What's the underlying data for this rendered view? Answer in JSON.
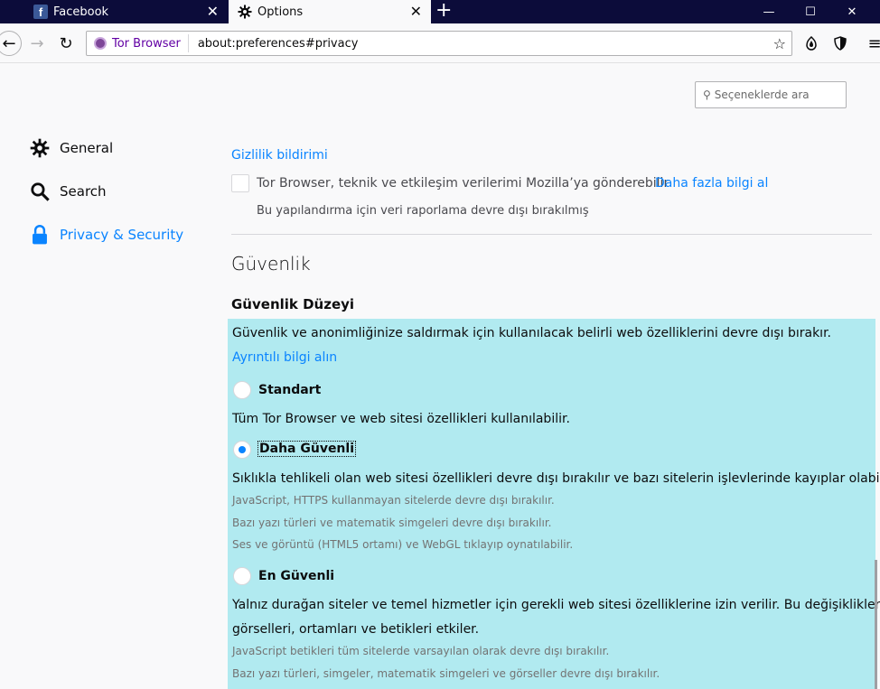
{
  "tabs": [
    {
      "title": "Facebook",
      "favicon": "facebook-icon"
    },
    {
      "title": "Options",
      "favicon": "gear-icon"
    }
  ],
  "window_controls": {
    "minimize": "—",
    "maximize": "☐",
    "close": "✕"
  },
  "navbar": {
    "identity_label": "Tor Browser",
    "url": "about:preferences#privacy"
  },
  "search": {
    "placeholder": "Seçeneklerde ara"
  },
  "sidebar": {
    "items": [
      {
        "label": "General"
      },
      {
        "label": "Search"
      },
      {
        "label": "Privacy & Security"
      }
    ]
  },
  "privacy": {
    "top_cut_text": "",
    "notice_link": "Gizlilik bildirimi",
    "telemetry_label": "Tor Browser, teknik ve etkileşim verilerimi Mozilla’ya gönderebilir",
    "telemetry_link": "Daha fazla bilgi al",
    "telemetry_note": "Bu yapılandırma için veri raporlama devre dışı bırakılmış"
  },
  "security": {
    "section_title": "Güvenlik",
    "level_title": "Güvenlik Düzeyi",
    "description": "Güvenlik ve anonimliğinize saldırmak için kullanılacak belirli web özelliklerini devre dışı bırakır.",
    "learn_more": "Ayrıntılı bilgi alın",
    "levels": [
      {
        "label": "Standart",
        "checked": false,
        "description": "Tüm Tor Browser ve web sitesi özellikleri kullanılabilir.",
        "details": []
      },
      {
        "label": "Daha Güvenli",
        "checked": true,
        "description": "Sıklıkla tehlikeli olan web sitesi özellikleri devre dışı bırakılır ve bazı sitelerin işlevlerinde kayıplar olabilir.",
        "details": [
          "JavaScript, HTTPS kullanmayan sitelerde devre dışı bırakılır.",
          "Bazı yazı türleri ve matematik simgeleri devre dışı bırakılır.",
          "Ses ve görüntü (HTML5 ortamı) ve WebGL tıklayıp oynatılabilir."
        ]
      },
      {
        "label": "En Güvenli",
        "checked": false,
        "description_line1": "Yalnız durağan siteler ve temel hizmetler için gerekli web sitesi özelliklerine izin verilir. Bu değişiklikler",
        "description_line2": "görselleri, ortamları ve betikleri etkiler.",
        "details": [
          "JavaScript betikleri tüm sitelerde varsayılan olarak devre dışı bırakılır.",
          "Bazı yazı türleri, simgeler, matematik simgeleri ve görseller devre dışı bırakılır."
        ]
      }
    ]
  },
  "colors": {
    "accent": "#0a84ff",
    "highlight_panel": "#b1eaf0",
    "tabstrip": "#0c0c3a"
  }
}
